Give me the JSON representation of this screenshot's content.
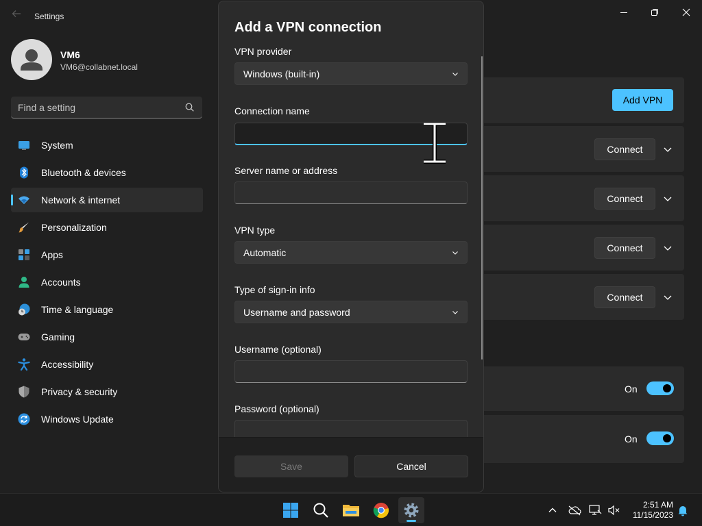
{
  "window": {
    "app_title": "Settings",
    "back_icon": "back-arrow-icon",
    "controls": [
      "minimize-icon",
      "restore-icon",
      "close-icon"
    ]
  },
  "user": {
    "name": "VM6",
    "email": "VM6@collabnet.local"
  },
  "search": {
    "placeholder": "Find a setting",
    "value": ""
  },
  "nav": {
    "items": [
      {
        "label": "System",
        "icon": "monitor-icon"
      },
      {
        "label": "Bluetooth & devices",
        "icon": "bluetooth-icon"
      },
      {
        "label": "Network & internet",
        "icon": "wifi-icon",
        "selected": true
      },
      {
        "label": "Personalization",
        "icon": "brush-icon"
      },
      {
        "label": "Apps",
        "icon": "apps-icon"
      },
      {
        "label": "Accounts",
        "icon": "person-icon"
      },
      {
        "label": "Time & language",
        "icon": "globe-clock-icon"
      },
      {
        "label": "Gaming",
        "icon": "gamepad-icon"
      },
      {
        "label": "Accessibility",
        "icon": "accessibility-icon"
      },
      {
        "label": "Privacy & security",
        "icon": "shield-icon"
      },
      {
        "label": "Windows Update",
        "icon": "update-icon"
      }
    ]
  },
  "vpn_page": {
    "add_vpn_label": "Add VPN",
    "connect_label": "Connect",
    "connections_count_visible": 4,
    "toggles": [
      {
        "state_label": "On",
        "on": true
      },
      {
        "state_label": "On",
        "on": true
      }
    ]
  },
  "dialog": {
    "title": "Add a VPN connection",
    "provider_label": "VPN provider",
    "provider_value": "Windows (built-in)",
    "connection_name_label": "Connection name",
    "connection_name_value": "",
    "server_label": "Server name or address",
    "server_value": "",
    "vpn_type_label": "VPN type",
    "vpn_type_value": "Automatic",
    "signin_label": "Type of sign-in info",
    "signin_value": "Username and password",
    "username_label": "Username (optional)",
    "username_value": "",
    "password_label": "Password (optional)",
    "save_label": "Save",
    "cancel_label": "Cancel"
  },
  "taskbar": {
    "apps": [
      "windows-start-icon",
      "search-icon",
      "file-explorer-icon",
      "chrome-icon",
      "settings-gear-icon"
    ],
    "active_app": "settings-gear-icon",
    "time": "2:51 AM",
    "date": "11/15/2023"
  },
  "colors": {
    "accent": "#4cc2ff",
    "background": "#202020",
    "card": "#2b2b2b"
  }
}
